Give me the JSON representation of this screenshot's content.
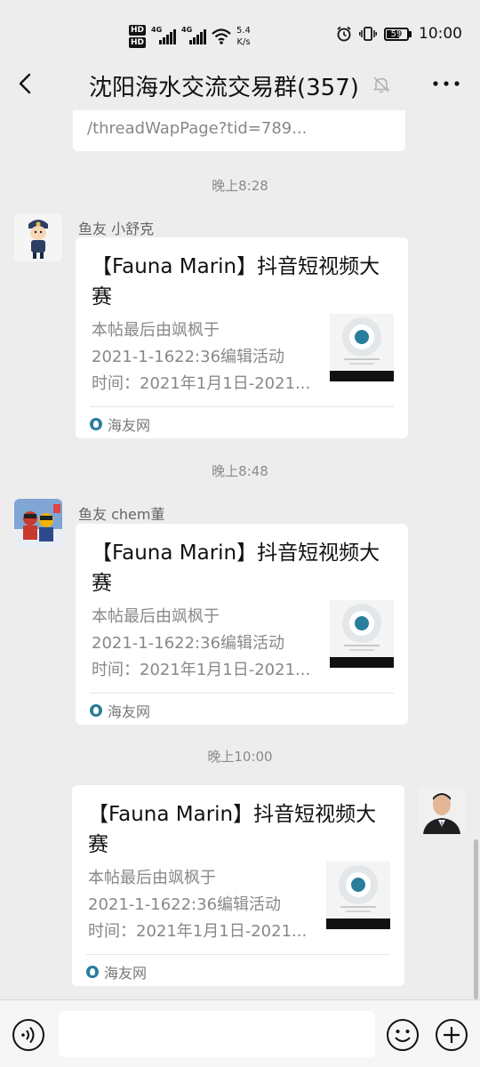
{
  "status_bar": {
    "hd1": "HD",
    "hd2": "HD",
    "net1": "4G",
    "net2": "4G",
    "speed_value": "5.4",
    "speed_unit": "K/s",
    "battery": "59",
    "time": "10:00"
  },
  "header": {
    "title": "沈阳海水交流交易群(357)"
  },
  "chat": {
    "top_card": {
      "partial_line": "/threadWapPage?tid=789..."
    },
    "messages": [
      {
        "time": "晚上8:28",
        "sender": "鱼友 小舒克",
        "title": "【Fauna Marin】抖音短视频大赛",
        "desc_line1": "本帖最后由飒枫于",
        "desc_line2": "2021-1-1622:36编辑活动",
        "desc_line3": "时间：2021年1月1日-2021...",
        "source": "海友网"
      },
      {
        "time": "晚上8:48",
        "sender": "鱼友 chem董",
        "title": "【Fauna Marin】抖音短视频大赛",
        "desc_line1": "本帖最后由飒枫于",
        "desc_line2": "2021-1-1622:36编辑活动",
        "desc_line3": "时间：2021年1月1日-2021...",
        "source": "海友网"
      },
      {
        "time": "晚上10:00",
        "title": "【Fauna Marin】抖音短视频大赛",
        "desc_line1": "本帖最后由飒枫于",
        "desc_line2": "2021-1-1622:36编辑活动",
        "desc_line3": "时间：2021年1月1日-2021...",
        "source": "海友网"
      }
    ]
  },
  "input": {
    "value": ""
  },
  "colors": {
    "background": "#ededed",
    "bubble": "#ffffff",
    "timestamp": "#8a8a8a",
    "source_logo": "#2a7d9c"
  }
}
